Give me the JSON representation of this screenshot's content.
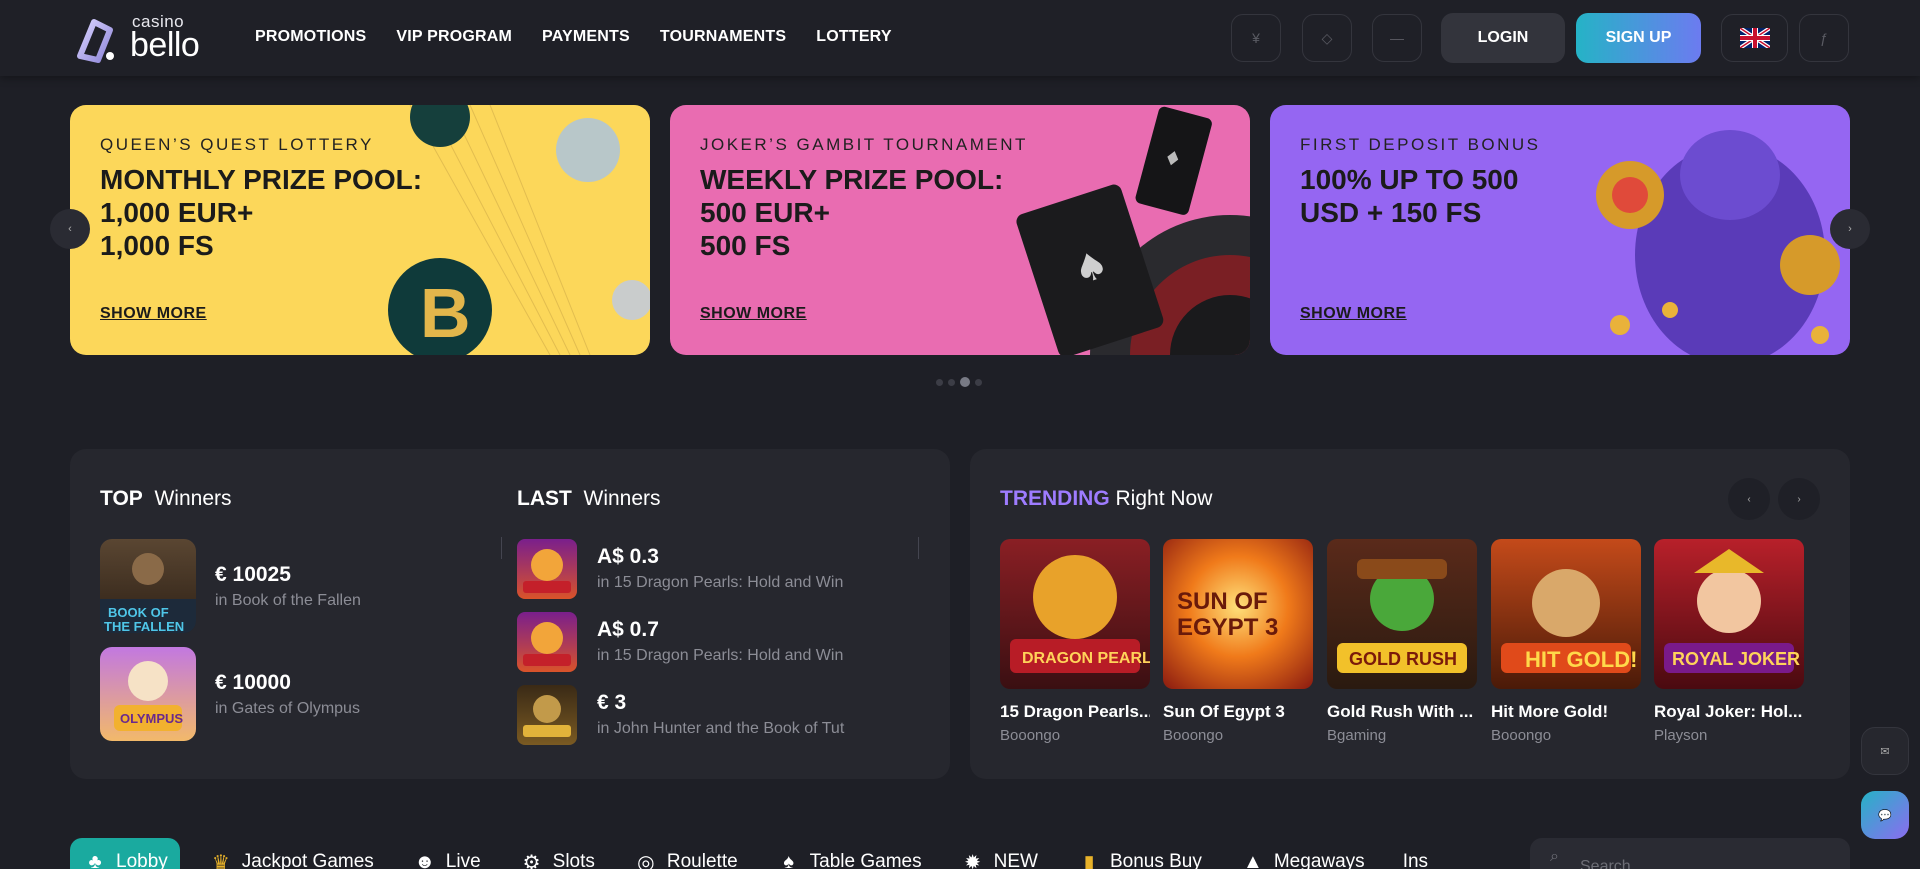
{
  "header": {
    "logo": {
      "small": "casino",
      "big": "bello"
    },
    "nav": [
      "PROMOTIONS",
      "VIP PROGRAM",
      "PAYMENTS",
      "TOURNAMENTS",
      "LOTTERY"
    ],
    "login_label": "LOGIN",
    "signup_label": "SIGN UP",
    "language": "EN"
  },
  "banners": [
    {
      "subtitle": "QUEEN’S QUEST LOTTERY",
      "title_lines": [
        "MONTHLY PRIZE POOL:",
        "1,000 EUR+",
        "1,000 FS"
      ],
      "cta": "SHOW MORE",
      "color": "#fcd75a"
    },
    {
      "subtitle": "JOKER’S GAMBIT TOURNAMENT",
      "title_lines": [
        "WEEKLY PRIZE POOL:",
        "500 EUR+",
        "500 FS"
      ],
      "cta": "SHOW MORE",
      "color": "#e96cb1"
    },
    {
      "subtitle": "FIRST DEPOSIT BONUS",
      "title_lines": [
        "100% UP TO 500",
        "USD + 150 FS"
      ],
      "cta": "SHOW MORE",
      "color": "#9566f2"
    }
  ],
  "carousel": {
    "active_index": 2,
    "count": 4
  },
  "top_winners": {
    "title_bold": "TOP",
    "title_rest": "Winners",
    "items": [
      {
        "amount": "€ 10025",
        "game": "in Book of the Fallen"
      },
      {
        "amount": "€ 10000",
        "game": "in Gates of Olympus"
      }
    ]
  },
  "last_winners": {
    "title_bold": "LAST",
    "title_rest": "Winners",
    "items": [
      {
        "amount": "A$ 0.3",
        "game": "in 15 Dragon Pearls: Hold and Win"
      },
      {
        "amount": "A$ 0.7",
        "game": "in 15 Dragon Pearls: Hold and Win"
      },
      {
        "amount": "€ 3",
        "game": "in John Hunter and the Book of Tut"
      }
    ]
  },
  "trending": {
    "title_accent": "TRENDING",
    "title_rest": "Right Now",
    "games": [
      {
        "name": "15 Dragon Pearls...",
        "provider": "Booongo"
      },
      {
        "name": "Sun Of Egypt 3",
        "provider": "Booongo"
      },
      {
        "name": "Gold Rush With ...",
        "provider": "Bgaming"
      },
      {
        "name": "Hit More Gold!",
        "provider": "Booongo"
      },
      {
        "name": "Royal Joker: Hol...",
        "provider": "Playson"
      }
    ]
  },
  "tabs": [
    {
      "label": "Lobby",
      "icon": "clover-icon",
      "active": true
    },
    {
      "label": "Jackpot Games",
      "icon": "crown-icon"
    },
    {
      "label": "Live",
      "icon": "dealer-icon"
    },
    {
      "label": "Slots",
      "icon": "slots-icon"
    },
    {
      "label": "Roulette",
      "icon": "roulette-icon"
    },
    {
      "label": "Table Games",
      "icon": "cards-icon"
    },
    {
      "label": "NEW",
      "icon": "new-badge-icon"
    },
    {
      "label": "Bonus Buy",
      "icon": "bonus-icon"
    },
    {
      "label": "Megaways",
      "icon": "megaways-icon"
    },
    {
      "label": "Ins",
      "icon": ""
    }
  ],
  "search": {
    "placeholder": "Search"
  },
  "colors": {
    "accent_teal": "#1aaa9f",
    "accent_purple": "#9e7cff",
    "bg": "#1e1f26"
  }
}
